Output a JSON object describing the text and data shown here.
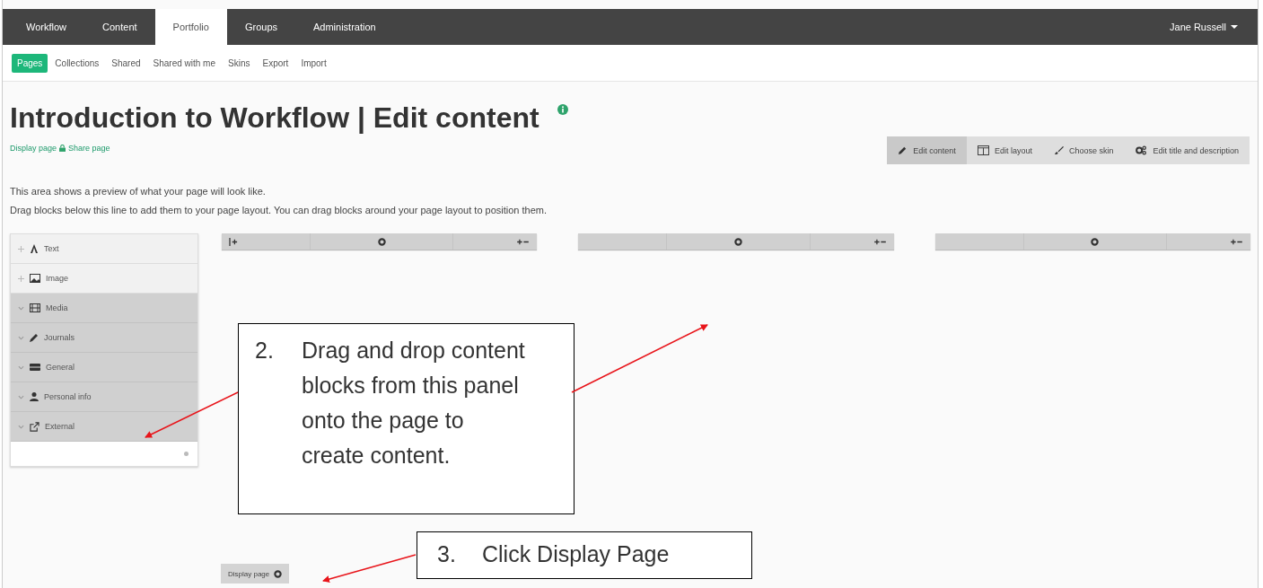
{
  "nav": {
    "tabs": [
      {
        "label": "Workflow",
        "selected": false
      },
      {
        "label": "Content",
        "selected": false
      },
      {
        "label": "Portfolio",
        "selected": true
      },
      {
        "label": "Groups",
        "selected": false
      },
      {
        "label": "Administration",
        "selected": false
      }
    ],
    "user": "Jane Russell"
  },
  "subnav": [
    {
      "label": "Pages",
      "selected": true
    },
    {
      "label": "Collections",
      "selected": false
    },
    {
      "label": "Shared",
      "selected": false
    },
    {
      "label": "Shared with me",
      "selected": false
    },
    {
      "label": "Skins",
      "selected": false
    },
    {
      "label": "Export",
      "selected": false
    },
    {
      "label": "Import",
      "selected": false
    }
  ],
  "title": "Introduction to Workflow | Edit content",
  "page_links": [
    "Display page",
    "Share page"
  ],
  "toolbar": [
    {
      "label": "Edit content",
      "selected": true
    },
    {
      "label": "Edit layout",
      "selected": false
    },
    {
      "label": "Choose skin",
      "selected": false
    },
    {
      "label": "Edit title and description",
      "selected": false
    }
  ],
  "instructions": [
    "This area shows a preview of what your page will look like.",
    "Drag blocks below this line to add them to your page layout. You can drag blocks around your page layout to position them."
  ],
  "blocks": [
    {
      "label": "Text",
      "kind": "block"
    },
    {
      "label": "Image",
      "kind": "block"
    },
    {
      "label": "Media",
      "kind": "category"
    },
    {
      "label": "Journals",
      "kind": "category"
    },
    {
      "label": "General",
      "kind": "category"
    },
    {
      "label": "Personal info",
      "kind": "category"
    },
    {
      "label": "External",
      "kind": "category"
    }
  ],
  "columns": [
    {
      "add_left": true
    },
    {
      "add_left": false
    },
    {
      "add_left": false
    }
  ],
  "display_button": "Display page",
  "callouts": [
    {
      "number": "2.",
      "text": "Drag and drop content blocks from this panel onto the page to create content."
    },
    {
      "number": "3.",
      "text": "Click Display Page"
    }
  ]
}
